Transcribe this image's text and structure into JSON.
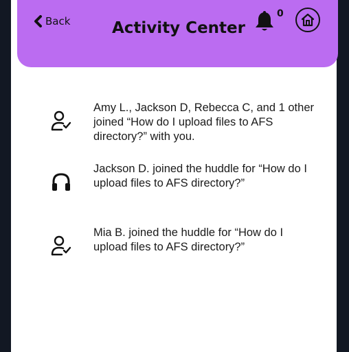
{
  "header": {
    "back_label": "Back",
    "title": "Activity Center",
    "notification_count": "0",
    "accent_color": "#bb6cf1"
  },
  "activities": [
    {
      "icon": "user-check-icon",
      "text": "Amy L., Jackson D, Rebecca C, and 1 other joined “How do I upload files to AFS directory?” with you."
    },
    {
      "icon": "headphones-icon",
      "text": "Jackson D. joined the huddle for “How do I upload files to AFS directory?”"
    },
    {
      "icon": "user-check-icon",
      "text": "Mia B. joined the huddle for “How do I upload files to AFS directory?”"
    }
  ]
}
